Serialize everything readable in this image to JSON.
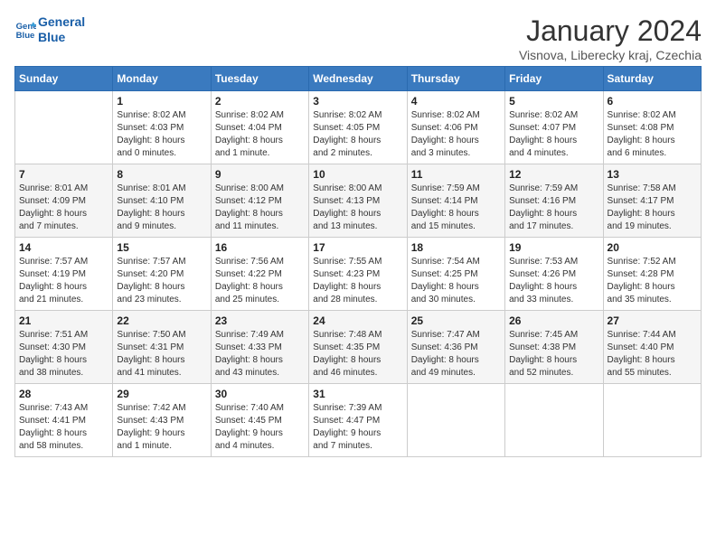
{
  "header": {
    "logo_line1": "General",
    "logo_line2": "Blue",
    "month_title": "January 2024",
    "location": "Visnova, Liberecky kraj, Czechia"
  },
  "weekdays": [
    "Sunday",
    "Monday",
    "Tuesday",
    "Wednesday",
    "Thursday",
    "Friday",
    "Saturday"
  ],
  "weeks": [
    [
      {
        "day": "",
        "info": ""
      },
      {
        "day": "1",
        "info": "Sunrise: 8:02 AM\nSunset: 4:03 PM\nDaylight: 8 hours\nand 0 minutes."
      },
      {
        "day": "2",
        "info": "Sunrise: 8:02 AM\nSunset: 4:04 PM\nDaylight: 8 hours\nand 1 minute."
      },
      {
        "day": "3",
        "info": "Sunrise: 8:02 AM\nSunset: 4:05 PM\nDaylight: 8 hours\nand 2 minutes."
      },
      {
        "day": "4",
        "info": "Sunrise: 8:02 AM\nSunset: 4:06 PM\nDaylight: 8 hours\nand 3 minutes."
      },
      {
        "day": "5",
        "info": "Sunrise: 8:02 AM\nSunset: 4:07 PM\nDaylight: 8 hours\nand 4 minutes."
      },
      {
        "day": "6",
        "info": "Sunrise: 8:02 AM\nSunset: 4:08 PM\nDaylight: 8 hours\nand 6 minutes."
      }
    ],
    [
      {
        "day": "7",
        "info": "Sunrise: 8:01 AM\nSunset: 4:09 PM\nDaylight: 8 hours\nand 7 minutes."
      },
      {
        "day": "8",
        "info": "Sunrise: 8:01 AM\nSunset: 4:10 PM\nDaylight: 8 hours\nand 9 minutes."
      },
      {
        "day": "9",
        "info": "Sunrise: 8:00 AM\nSunset: 4:12 PM\nDaylight: 8 hours\nand 11 minutes."
      },
      {
        "day": "10",
        "info": "Sunrise: 8:00 AM\nSunset: 4:13 PM\nDaylight: 8 hours\nand 13 minutes."
      },
      {
        "day": "11",
        "info": "Sunrise: 7:59 AM\nSunset: 4:14 PM\nDaylight: 8 hours\nand 15 minutes."
      },
      {
        "day": "12",
        "info": "Sunrise: 7:59 AM\nSunset: 4:16 PM\nDaylight: 8 hours\nand 17 minutes."
      },
      {
        "day": "13",
        "info": "Sunrise: 7:58 AM\nSunset: 4:17 PM\nDaylight: 8 hours\nand 19 minutes."
      }
    ],
    [
      {
        "day": "14",
        "info": "Sunrise: 7:57 AM\nSunset: 4:19 PM\nDaylight: 8 hours\nand 21 minutes."
      },
      {
        "day": "15",
        "info": "Sunrise: 7:57 AM\nSunset: 4:20 PM\nDaylight: 8 hours\nand 23 minutes."
      },
      {
        "day": "16",
        "info": "Sunrise: 7:56 AM\nSunset: 4:22 PM\nDaylight: 8 hours\nand 25 minutes."
      },
      {
        "day": "17",
        "info": "Sunrise: 7:55 AM\nSunset: 4:23 PM\nDaylight: 8 hours\nand 28 minutes."
      },
      {
        "day": "18",
        "info": "Sunrise: 7:54 AM\nSunset: 4:25 PM\nDaylight: 8 hours\nand 30 minutes."
      },
      {
        "day": "19",
        "info": "Sunrise: 7:53 AM\nSunset: 4:26 PM\nDaylight: 8 hours\nand 33 minutes."
      },
      {
        "day": "20",
        "info": "Sunrise: 7:52 AM\nSunset: 4:28 PM\nDaylight: 8 hours\nand 35 minutes."
      }
    ],
    [
      {
        "day": "21",
        "info": "Sunrise: 7:51 AM\nSunset: 4:30 PM\nDaylight: 8 hours\nand 38 minutes."
      },
      {
        "day": "22",
        "info": "Sunrise: 7:50 AM\nSunset: 4:31 PM\nDaylight: 8 hours\nand 41 minutes."
      },
      {
        "day": "23",
        "info": "Sunrise: 7:49 AM\nSunset: 4:33 PM\nDaylight: 8 hours\nand 43 minutes."
      },
      {
        "day": "24",
        "info": "Sunrise: 7:48 AM\nSunset: 4:35 PM\nDaylight: 8 hours\nand 46 minutes."
      },
      {
        "day": "25",
        "info": "Sunrise: 7:47 AM\nSunset: 4:36 PM\nDaylight: 8 hours\nand 49 minutes."
      },
      {
        "day": "26",
        "info": "Sunrise: 7:45 AM\nSunset: 4:38 PM\nDaylight: 8 hours\nand 52 minutes."
      },
      {
        "day": "27",
        "info": "Sunrise: 7:44 AM\nSunset: 4:40 PM\nDaylight: 8 hours\nand 55 minutes."
      }
    ],
    [
      {
        "day": "28",
        "info": "Sunrise: 7:43 AM\nSunset: 4:41 PM\nDaylight: 8 hours\nand 58 minutes."
      },
      {
        "day": "29",
        "info": "Sunrise: 7:42 AM\nSunset: 4:43 PM\nDaylight: 9 hours\nand 1 minute."
      },
      {
        "day": "30",
        "info": "Sunrise: 7:40 AM\nSunset: 4:45 PM\nDaylight: 9 hours\nand 4 minutes."
      },
      {
        "day": "31",
        "info": "Sunrise: 7:39 AM\nSunset: 4:47 PM\nDaylight: 9 hours\nand 7 minutes."
      },
      {
        "day": "",
        "info": ""
      },
      {
        "day": "",
        "info": ""
      },
      {
        "day": "",
        "info": ""
      }
    ]
  ]
}
